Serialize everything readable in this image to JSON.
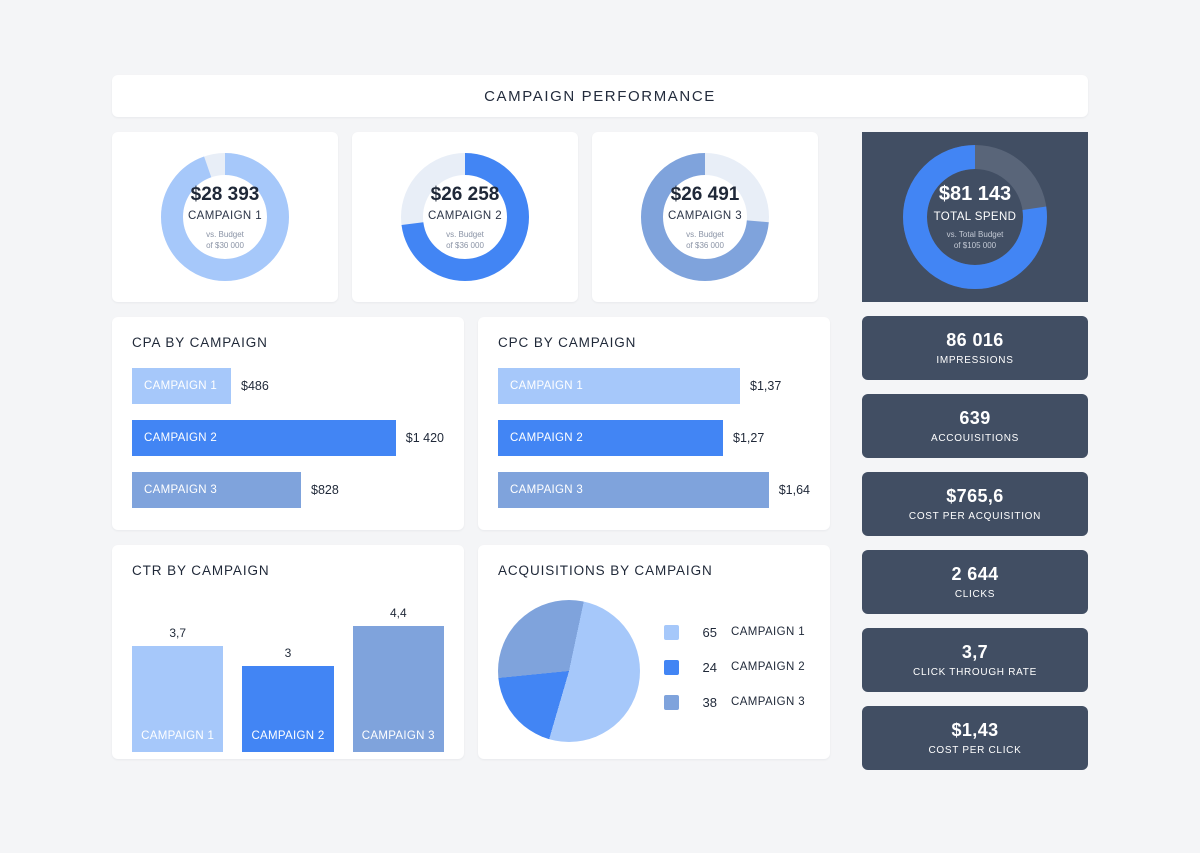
{
  "header": {
    "title": "CAMPAIGN PERFORMANCE"
  },
  "colors": {
    "campaign1": "#a6c8fa",
    "campaign2": "#4285f4",
    "campaign3": "#7fa3dc",
    "track_light": "#e8eef7",
    "track_dark": "#596579",
    "dark_card": "#414e63",
    "page_bg": "#f4f5f7"
  },
  "donuts": [
    {
      "value": "$28 393",
      "label": "CAMPAIGN 1",
      "sub_line1": "vs. Budget",
      "sub_line2": "of  $30 000",
      "percent": 94.6,
      "color": "#a6c8fa",
      "track": "#e8eef7",
      "theme": "light"
    },
    {
      "value": "$26 258",
      "label": "CAMPAIGN 2",
      "sub_line1": "vs. Budget",
      "sub_line2": "of  $36 000",
      "percent": 72.9,
      "color": "#4285f4",
      "track": "#e8eef7",
      "theme": "light"
    },
    {
      "value": "$26 491",
      "label": "CAMPAIGN 3",
      "sub_line1": "vs. Budget",
      "sub_line2": "of  $36 000",
      "percent": 73.6,
      "color": "#7fa3dc",
      "track": "#e8eef7",
      "theme": "light"
    },
    {
      "value": "$81 143",
      "label": "TOTAL SPEND",
      "sub_line1": "vs. Total Budget",
      "sub_line2": "of  $105 000",
      "percent": 77.3,
      "color": "#4285f4",
      "track": "#596579",
      "theme": "dark"
    }
  ],
  "chart_data": [
    {
      "type": "bar",
      "orientation": "horizontal",
      "title": "CPA BY CAMPAIGN",
      "categories": [
        "CAMPAIGN 1",
        "CAMPAIGN 2",
        "CAMPAIGN 3"
      ],
      "values": [
        486,
        1420,
        828
      ],
      "value_labels": [
        "$486",
        "$1 420",
        "$828"
      ],
      "colors": [
        "#a6c8fa",
        "#4285f4",
        "#7fa3dc"
      ],
      "xlabel": "",
      "ylabel": "",
      "xlim": [
        0,
        1420
      ],
      "grid": false,
      "legend": "none"
    },
    {
      "type": "bar",
      "orientation": "horizontal",
      "title": "CPC BY CAMPAIGN",
      "categories": [
        "CAMPAIGN 1",
        "CAMPAIGN 2",
        "CAMPAIGN 3"
      ],
      "values": [
        1.37,
        1.27,
        1.64
      ],
      "value_labels": [
        "$1,37",
        "$1,27",
        "$1,64"
      ],
      "colors": [
        "#a6c8fa",
        "#4285f4",
        "#7fa3dc"
      ],
      "xlabel": "",
      "ylabel": "",
      "xlim": [
        0,
        1.64
      ],
      "grid": false,
      "legend": "none"
    },
    {
      "type": "bar",
      "orientation": "vertical",
      "title": "CTR BY CAMPAIGN",
      "categories": [
        "CAMPAIGN 1",
        "CAMPAIGN 2",
        "CAMPAIGN 3"
      ],
      "values": [
        3.7,
        3,
        4.4
      ],
      "value_labels": [
        "3,7",
        "3",
        "4,4"
      ],
      "colors": [
        "#a6c8fa",
        "#4285f4",
        "#7fa3dc"
      ],
      "xlabel": "",
      "ylabel": "",
      "ylim": [
        0,
        4.4
      ],
      "grid": false,
      "legend": "none"
    },
    {
      "type": "pie",
      "title": "ACQUISITIONS BY CAMPAIGN",
      "categories": [
        "CAMPAIGN 1",
        "CAMPAIGN 2",
        "CAMPAIGN 3"
      ],
      "values": [
        65,
        24,
        38
      ],
      "colors": [
        "#a6c8fa",
        "#4285f4",
        "#7fa3dc"
      ],
      "total": 127,
      "legend": "right"
    }
  ],
  "kpis": [
    {
      "value": "86 016",
      "label": "IMPRESSIONS"
    },
    {
      "value": "639",
      "label": "ACCOUISITIONS"
    },
    {
      "value": "$765,6",
      "label": "COST PER ACQUISITION"
    },
    {
      "value": "2 644",
      "label": "CLICKS"
    },
    {
      "value": "3,7",
      "label": "CLICK THROUGH RATE"
    },
    {
      "value": "$1,43",
      "label": "COST PER CLICK"
    }
  ]
}
